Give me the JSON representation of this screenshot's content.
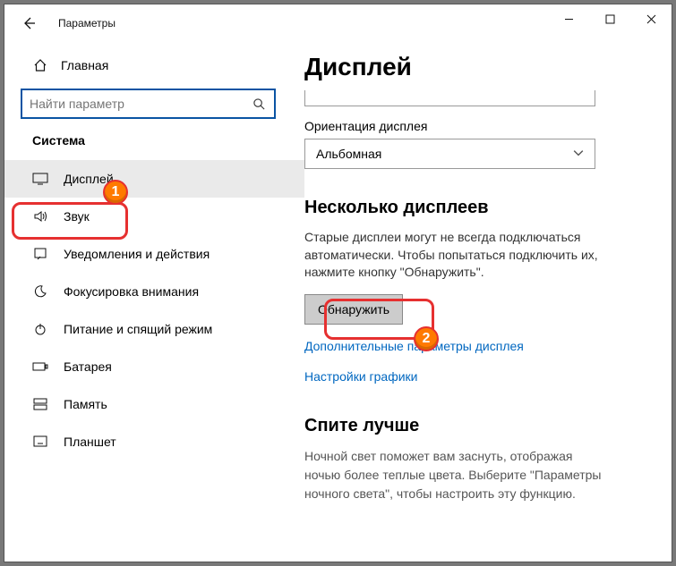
{
  "titlebar": {
    "title": "Параметры"
  },
  "sidebar": {
    "home": "Главная",
    "search_placeholder": "Найти параметр",
    "section": "Система",
    "items": [
      {
        "label": "Дисплей"
      },
      {
        "label": "Звук"
      },
      {
        "label": "Уведомления и действия"
      },
      {
        "label": "Фокусировка внимания"
      },
      {
        "label": "Питание и спящий режим"
      },
      {
        "label": "Батарея"
      },
      {
        "label": "Память"
      },
      {
        "label": "Планшет"
      }
    ]
  },
  "page": {
    "title": "Дисплей",
    "orientation_label": "Ориентация дисплея",
    "orientation_value": "Альбомная",
    "multi_heading": "Несколько дисплеев",
    "multi_body": "Старые дисплеи могут не всегда подключаться автоматически. Чтобы попытаться подключить их, нажмите кнопку \"Обнаружить\".",
    "detect_btn": "Обнаружить",
    "link_advanced": "Дополнительные параметры дисплея",
    "link_graphics": "Настройки графики",
    "sleep_heading": "Спите лучше",
    "sleep_body": "Ночной свет поможет вам заснуть, отображая ночью более теплые цвета. Выберите \"Параметры ночного света\", чтобы настроить эту функцию."
  },
  "annotations": {
    "badge1": "1",
    "badge2": "2"
  }
}
